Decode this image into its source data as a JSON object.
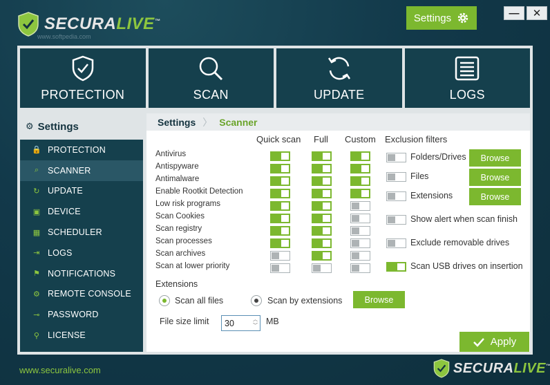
{
  "app": {
    "logo_secura": "SECURA",
    "logo_live": "LIVE",
    "watermark": "www.softpedia.com",
    "settings_label": "Settings",
    "minimize": "—",
    "close": "✕"
  },
  "tiles": [
    {
      "label": "PROTECTION",
      "icon": "shield-check-icon"
    },
    {
      "label": "SCAN",
      "icon": "magnifier-icon"
    },
    {
      "label": "UPDATE",
      "icon": "refresh-icon"
    },
    {
      "label": "LOGS",
      "icon": "list-icon"
    }
  ],
  "sidebar": {
    "title": "Settings",
    "items": [
      {
        "label": "PROTECTION",
        "icon": "lock-icon",
        "glyph": "🔒"
      },
      {
        "label": "SCANNER",
        "icon": "search-icon",
        "glyph": "⌕"
      },
      {
        "label": "UPDATE",
        "icon": "refresh-icon",
        "glyph": "↻"
      },
      {
        "label": "DEVICE",
        "icon": "device-icon",
        "glyph": "▣"
      },
      {
        "label": "SCHEDULER",
        "icon": "calendar-icon",
        "glyph": "▦"
      },
      {
        "label": "LOGS",
        "icon": "login-icon",
        "glyph": "⇥"
      },
      {
        "label": "NOTIFICATIONS",
        "icon": "flag-icon",
        "glyph": "⚑"
      },
      {
        "label": "REMOTE CONSOLE",
        "icon": "remote-icon",
        "glyph": "⚙"
      },
      {
        "label": "PASSWORD",
        "icon": "key-icon",
        "glyph": "⊸"
      },
      {
        "label": "LICENSE",
        "icon": "license-icon",
        "glyph": "⚲"
      }
    ],
    "active_index": 1
  },
  "breadcrumb": {
    "root": "Settings",
    "current": "Scanner"
  },
  "columns": {
    "quick": "Quick scan",
    "full": "Full",
    "custom": "Custom",
    "exclusions": "Exclusion filters"
  },
  "scan_rows": [
    {
      "label": "Antivirus",
      "quick": true,
      "full": true,
      "custom": true
    },
    {
      "label": "Antispyware",
      "quick": true,
      "full": true,
      "custom": true
    },
    {
      "label": "Antimalware",
      "quick": true,
      "full": true,
      "custom": true
    },
    {
      "label": "Enable Rootkit Detection",
      "quick": true,
      "full": true,
      "custom": true
    },
    {
      "label": "Low risk programs",
      "quick": true,
      "full": true,
      "custom": false
    },
    {
      "label": "Scan Cookies",
      "quick": true,
      "full": true,
      "custom": false
    },
    {
      "label": "Scan registry",
      "quick": true,
      "full": true,
      "custom": false
    },
    {
      "label": "Scan processes",
      "quick": true,
      "full": true,
      "custom": false
    },
    {
      "label": "Scan archives",
      "quick": false,
      "full": true,
      "custom": false
    },
    {
      "label": "Scan at lower priority",
      "quick": false,
      "full": false,
      "custom": false
    }
  ],
  "exclusions": [
    {
      "label": "Folders/Drives",
      "on": false,
      "button": "Browse"
    },
    {
      "label": "Files",
      "on": false,
      "button": "Browse"
    },
    {
      "label": "Extensions",
      "on": false,
      "button": "Browse"
    }
  ],
  "options": [
    {
      "label": "Show alert when scan finish",
      "on": false
    },
    {
      "label": "Exclude removable drives",
      "on": false
    },
    {
      "label": "Scan USB drives on insertion",
      "on": true
    }
  ],
  "extensions": {
    "title": "Extensions",
    "scan_all": "Scan all files",
    "scan_by_ext": "Scan by extensions",
    "browse": "Browse",
    "selected": "scan_all"
  },
  "file_size": {
    "label": "File size limit",
    "value": "30",
    "unit": "MB"
  },
  "apply_label": "Apply",
  "footer": {
    "url": "www.securalive.com"
  },
  "colors": {
    "accent": "#7cb82f",
    "navy": "#15404d"
  }
}
